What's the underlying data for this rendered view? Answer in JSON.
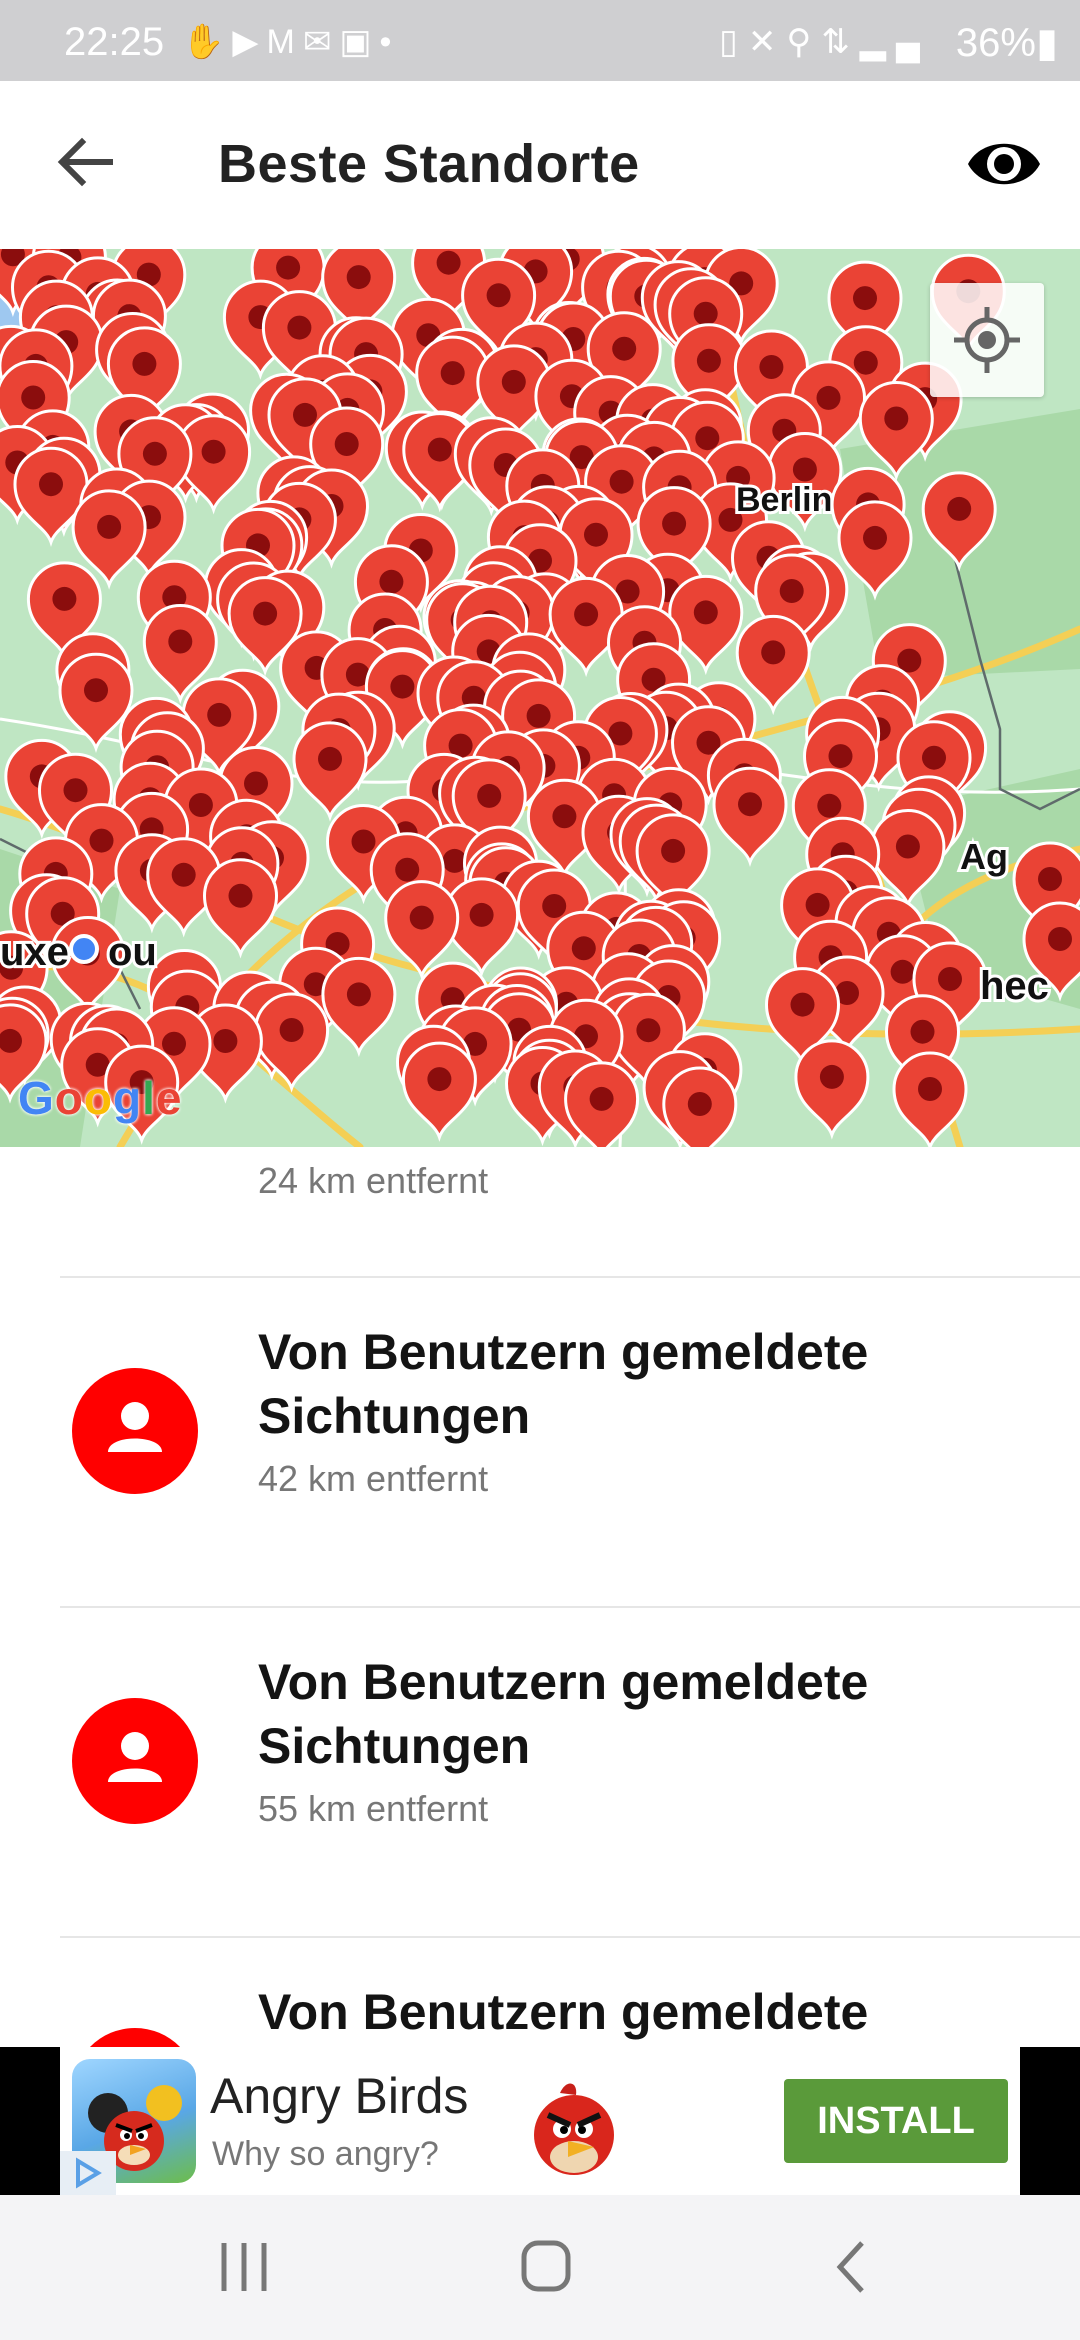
{
  "status_bar": {
    "time": "22:25",
    "battery": "36%",
    "left_icons": [
      "hand-icon",
      "video-icon",
      "gmail-icon",
      "mail-icon",
      "image-icon",
      "dot-icon"
    ],
    "right_icons": [
      "battery-saver-icon",
      "mute-icon",
      "location-icon",
      "4g-icon",
      "signal-icon"
    ]
  },
  "app_bar": {
    "title": "Beste Standorte",
    "back_icon": "arrow-back-icon",
    "action_icon": "eye-icon"
  },
  "map": {
    "google_logo": "Google",
    "labels": [
      "Berlin",
      "uxe",
      "ou",
      "Ag",
      "hec"
    ],
    "pin_color": "#ea4335",
    "pin_center_color": "#8b0d0d",
    "user_location_color": "#4285f4"
  },
  "list": {
    "items": [
      {
        "name": "",
        "distance": "24 km entfernt"
      },
      {
        "name": "Von Benutzern gemeldete Sichtungen",
        "distance": "42 km entfernt"
      },
      {
        "name": "Von Benutzern gemeldete Sichtungen",
        "distance": "55 km entfernt"
      },
      {
        "name": "Von Benutzern gemeldete",
        "distance": ""
      }
    ],
    "avatar_color": "#ff0000",
    "avatar_icon": "person-icon"
  },
  "ad": {
    "title": "Angry Birds",
    "subtitle": "Why so angry?",
    "button": "INSTALL",
    "button_color": "#5a9a3a"
  },
  "nav_bar": {
    "icons": [
      "recents-icon",
      "home-icon",
      "back-nav-icon"
    ]
  }
}
